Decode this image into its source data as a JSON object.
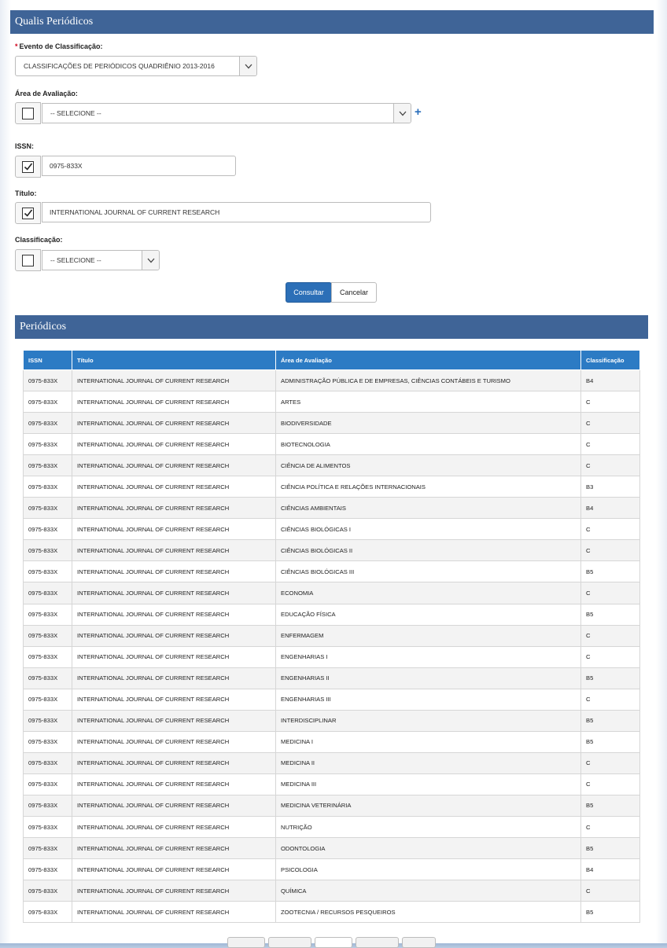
{
  "panel_title": "Qualis Periódicos",
  "form": {
    "evento_label": "Evento de Classificação:",
    "required_mark": "*",
    "evento_value": "CLASSIFICAÇÕES DE PERIÓDICOS QUADRIÊNIO 2013-2016",
    "area_label": "Área de Avaliação:",
    "area_value": "-- SELECIONE --",
    "issn_label": "ISSN:",
    "issn_value": "0975-833X",
    "titulo_label": "Título:",
    "titulo_value": "INTERNATIONAL JOURNAL OF CURRENT RESEARCH",
    "classificacao_label": "Classificação:",
    "classificacao_value": "-- SELECIONE --",
    "plus_icon": "+",
    "consultar_label": "Consultar",
    "cancelar_label": "Cancelar"
  },
  "results": {
    "title": "Periódicos",
    "columns": [
      "ISSN",
      "Título",
      "Área de Avaliação",
      "Classificação"
    ],
    "rows": [
      [
        "0975-833X",
        "INTERNATIONAL JOURNAL OF CURRENT RESEARCH",
        "ADMINISTRAÇÃO PÚBLICA E DE EMPRESAS, CIÊNCIAS CONTÁBEIS E TURISMO",
        "B4"
      ],
      [
        "0975-833X",
        "INTERNATIONAL JOURNAL OF CURRENT RESEARCH",
        "ARTES",
        "C"
      ],
      [
        "0975-833X",
        "INTERNATIONAL JOURNAL OF CURRENT RESEARCH",
        "BIODIVERSIDADE",
        "C"
      ],
      [
        "0975-833X",
        "INTERNATIONAL JOURNAL OF CURRENT RESEARCH",
        "BIOTECNOLOGIA",
        "C"
      ],
      [
        "0975-833X",
        "INTERNATIONAL JOURNAL OF CURRENT RESEARCH",
        "CIÊNCIA DE ALIMENTOS",
        "C"
      ],
      [
        "0975-833X",
        "INTERNATIONAL JOURNAL OF CURRENT RESEARCH",
        "CIÊNCIA POLÍTICA E RELAÇÕES INTERNACIONAIS",
        "B3"
      ],
      [
        "0975-833X",
        "INTERNATIONAL JOURNAL OF CURRENT RESEARCH",
        "CIÊNCIAS AMBIENTAIS",
        "B4"
      ],
      [
        "0975-833X",
        "INTERNATIONAL JOURNAL OF CURRENT RESEARCH",
        "CIÊNCIAS BIOLÓGICAS I",
        "C"
      ],
      [
        "0975-833X",
        "INTERNATIONAL JOURNAL OF CURRENT RESEARCH",
        "CIÊNCIAS BIOLÓGICAS II",
        "C"
      ],
      [
        "0975-833X",
        "INTERNATIONAL JOURNAL OF CURRENT RESEARCH",
        "CIÊNCIAS BIOLÓGICAS III",
        "B5"
      ],
      [
        "0975-833X",
        "INTERNATIONAL JOURNAL OF CURRENT RESEARCH",
        "ECONOMIA",
        "C"
      ],
      [
        "0975-833X",
        "INTERNATIONAL JOURNAL OF CURRENT RESEARCH",
        "EDUCAÇÃO FÍSICA",
        "B5"
      ],
      [
        "0975-833X",
        "INTERNATIONAL JOURNAL OF CURRENT RESEARCH",
        "ENFERMAGEM",
        "C"
      ],
      [
        "0975-833X",
        "INTERNATIONAL JOURNAL OF CURRENT RESEARCH",
        "ENGENHARIAS I",
        "C"
      ],
      [
        "0975-833X",
        "INTERNATIONAL JOURNAL OF CURRENT RESEARCH",
        "ENGENHARIAS II",
        "B5"
      ],
      [
        "0975-833X",
        "INTERNATIONAL JOURNAL OF CURRENT RESEARCH",
        "ENGENHARIAS III",
        "C"
      ],
      [
        "0975-833X",
        "INTERNATIONAL JOURNAL OF CURRENT RESEARCH",
        "INTERDISCIPLINAR",
        "B5"
      ],
      [
        "0975-833X",
        "INTERNATIONAL JOURNAL OF CURRENT RESEARCH",
        "MEDICINA I",
        "B5"
      ],
      [
        "0975-833X",
        "INTERNATIONAL JOURNAL OF CURRENT RESEARCH",
        "MEDICINA II",
        "C"
      ],
      [
        "0975-833X",
        "INTERNATIONAL JOURNAL OF CURRENT RESEARCH",
        "MEDICINA III",
        "C"
      ],
      [
        "0975-833X",
        "INTERNATIONAL JOURNAL OF CURRENT RESEARCH",
        "MEDICINA VETERINÁRIA",
        "B5"
      ],
      [
        "0975-833X",
        "INTERNATIONAL JOURNAL OF CURRENT RESEARCH",
        "NUTRIÇÃO",
        "C"
      ],
      [
        "0975-833X",
        "INTERNATIONAL JOURNAL OF CURRENT RESEARCH",
        "ODONTOLOGIA",
        "B5"
      ],
      [
        "0975-833X",
        "INTERNATIONAL JOURNAL OF CURRENT RESEARCH",
        "PSICOLOGIA",
        "B4"
      ],
      [
        "0975-833X",
        "INTERNATIONAL JOURNAL OF CURRENT RESEARCH",
        "QUÍMICA",
        "C"
      ],
      [
        "0975-833X",
        "INTERNATIONAL JOURNAL OF CURRENT RESEARCH",
        "ZOOTECNIA / RECURSOS PESQUEIROS",
        "B5"
      ]
    ]
  },
  "icons": {
    "caret": "chevron-down-icon",
    "check": "checkmark-icon",
    "add": "plus-icon"
  },
  "colors": {
    "header_bg": "#3f6497",
    "table_header_bg": "#2c7bc4",
    "primary_button": "#2c6fb7",
    "required": "#d0021b"
  }
}
